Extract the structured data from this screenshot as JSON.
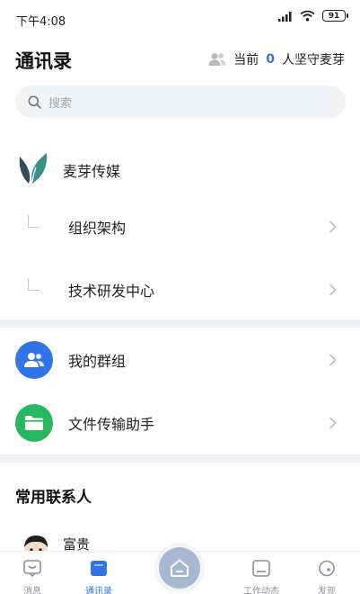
{
  "status_bar": {
    "time": "下午4:08",
    "battery": "91"
  },
  "header": {
    "title": "通讯录",
    "online_prefix": "当前",
    "online_count": "0",
    "online_suffix": "人坚守麦芽"
  },
  "search": {
    "placeholder": "搜索"
  },
  "organization": {
    "name": "麦芽传媒",
    "departments": [
      {
        "label": "组织架构"
      },
      {
        "label": "技术研发中心"
      }
    ]
  },
  "tools": [
    {
      "label": "我的群组",
      "icon": "group-icon",
      "color": "#2f74e8"
    },
    {
      "label": "文件传输助手",
      "icon": "folder-icon",
      "color": "#27b760"
    }
  ],
  "frequent_contacts": {
    "title": "常用联系人",
    "items": [
      {
        "name": "富贵"
      }
    ]
  },
  "tabbar": {
    "tabs": [
      {
        "label": "消息",
        "icon": "message-icon",
        "active": false
      },
      {
        "label": "通讯录",
        "icon": "contacts-icon",
        "active": true
      },
      {
        "label": "",
        "icon": "home-icon",
        "active": false
      },
      {
        "label": "工作动态",
        "icon": "work-feed-icon",
        "active": false
      },
      {
        "label": "发现",
        "icon": "discover-icon",
        "active": false
      }
    ]
  },
  "colors": {
    "accent": "#2f74e8",
    "green": "#27b760",
    "divider": "#eef1f6"
  }
}
